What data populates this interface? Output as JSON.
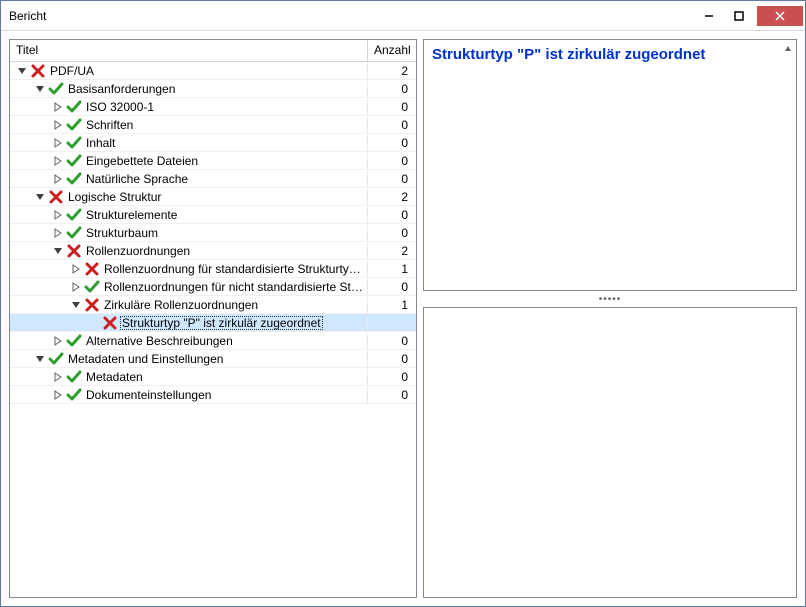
{
  "window": {
    "title": "Bericht"
  },
  "columns": {
    "title": "Titel",
    "count": "Anzahl"
  },
  "detail": {
    "title": "Strukturtyp \"P\" ist zirkulär zugeordnet"
  },
  "splitter": {
    "dots": "•••••"
  },
  "tree": [
    {
      "id": 0,
      "indent": 0,
      "expander": "open",
      "status": "error",
      "label": "PDF/UA",
      "count": "2"
    },
    {
      "id": 1,
      "indent": 1,
      "expander": "open",
      "status": "ok",
      "label": "Basisanforderungen",
      "count": "0"
    },
    {
      "id": 2,
      "indent": 2,
      "expander": "closed",
      "status": "ok",
      "label": "ISO 32000-1",
      "count": "0"
    },
    {
      "id": 3,
      "indent": 2,
      "expander": "closed",
      "status": "ok",
      "label": "Schriften",
      "count": "0"
    },
    {
      "id": 4,
      "indent": 2,
      "expander": "closed",
      "status": "ok",
      "label": "Inhalt",
      "count": "0"
    },
    {
      "id": 5,
      "indent": 2,
      "expander": "closed",
      "status": "ok",
      "label": "Eingebettete Dateien",
      "count": "0"
    },
    {
      "id": 6,
      "indent": 2,
      "expander": "closed",
      "status": "ok",
      "label": "Natürliche Sprache",
      "count": "0"
    },
    {
      "id": 7,
      "indent": 1,
      "expander": "open",
      "status": "error",
      "label": "Logische Struktur",
      "count": "2"
    },
    {
      "id": 8,
      "indent": 2,
      "expander": "closed",
      "status": "ok",
      "label": "Strukturelemente",
      "count": "0"
    },
    {
      "id": 9,
      "indent": 2,
      "expander": "closed",
      "status": "ok",
      "label": "Strukturbaum",
      "count": "0"
    },
    {
      "id": 10,
      "indent": 2,
      "expander": "open",
      "status": "error",
      "label": "Rollenzuordnungen",
      "count": "2"
    },
    {
      "id": 11,
      "indent": 3,
      "expander": "closed",
      "status": "error",
      "label": "Rollenzuordnung für standardisierte Strukturty…",
      "count": "1"
    },
    {
      "id": 12,
      "indent": 3,
      "expander": "closed",
      "status": "ok",
      "label": "Rollenzuordnungen für nicht standardisierte Str…",
      "count": "0"
    },
    {
      "id": 13,
      "indent": 3,
      "expander": "open",
      "status": "error",
      "label": "Zirkuläre Rollenzuordnungen",
      "count": "1"
    },
    {
      "id": 14,
      "indent": 4,
      "expander": "none",
      "status": "error",
      "label": "Strukturtyp \"P\" ist zirkulär zugeordnet",
      "count": "",
      "selected": true,
      "indicator": true
    },
    {
      "id": 15,
      "indent": 2,
      "expander": "closed",
      "status": "ok",
      "label": "Alternative Beschreibungen",
      "count": "0"
    },
    {
      "id": 16,
      "indent": 1,
      "expander": "open",
      "status": "ok",
      "label": "Metadaten und Einstellungen",
      "count": "0"
    },
    {
      "id": 17,
      "indent": 2,
      "expander": "closed",
      "status": "ok",
      "label": "Metadaten",
      "count": "0"
    },
    {
      "id": 18,
      "indent": 2,
      "expander": "closed",
      "status": "ok",
      "label": "Dokumenteinstellungen",
      "count": "0"
    }
  ]
}
